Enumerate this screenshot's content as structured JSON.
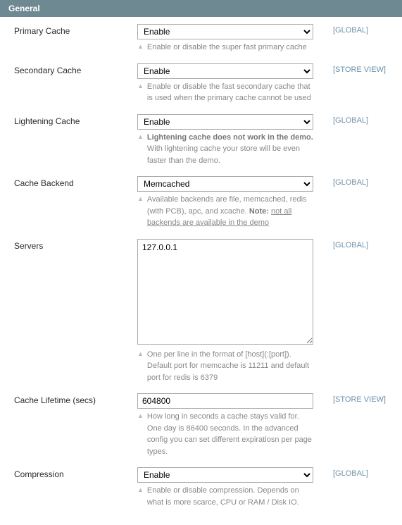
{
  "section_title": "General",
  "scope": {
    "global": "[GLOBAL]",
    "store_view": "[STORE VIEW]"
  },
  "fields": {
    "primary_cache": {
      "label": "Primary Cache",
      "value": "Enable",
      "hint": "Enable or disable the super fast primary cache"
    },
    "secondary_cache": {
      "label": "Secondary Cache",
      "value": "Enable",
      "hint": "Enable or disable the fast secondary cache that is used when the primary cache cannot be used"
    },
    "lightening_cache": {
      "label": "Lightening Cache",
      "value": "Enable",
      "hint_bold": "Lightening cache does not work in the demo.",
      "hint_rest": " With lightening cache your store will be even faster than the demo."
    },
    "cache_backend": {
      "label": "Cache Backend",
      "value": "Memcached",
      "hint_pre": "Available backends are file, memcached, redis (with PCB), apc, and xcache. ",
      "hint_note_label": "Note: ",
      "hint_link": "not all backends are available in the demo"
    },
    "servers": {
      "label": "Servers",
      "value": "127.0.0.1",
      "hint": "One per line in the format of [host](:[port]). Default port for memcache is 11211 and default port for redis is 6379"
    },
    "cache_lifetime": {
      "label": "Cache Lifetime (secs)",
      "value": "604800",
      "hint": "How long in seconds a cache stays valid for. One day is 86400 seconds. In the advanced config you can set different expiratiosn per page types."
    },
    "compression": {
      "label": "Compression",
      "value": "Enable",
      "hint": "Enable or disable compression. Depends on what is more scarce, CPU or RAM / Disk IO."
    }
  }
}
